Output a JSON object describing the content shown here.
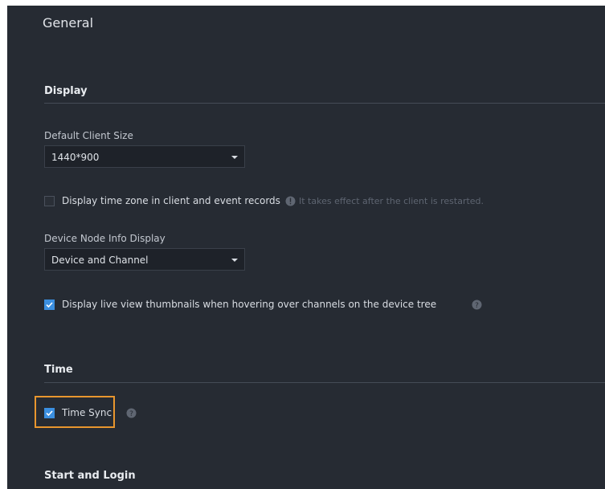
{
  "page": {
    "title": "General"
  },
  "display": {
    "section_title": "Display",
    "client_size": {
      "label": "Default Client Size",
      "value": "1440*900"
    },
    "time_zone": {
      "checked": false,
      "label": "Display time zone in client and event records",
      "hint": "It takes effect after the client is restarted."
    },
    "node_info": {
      "label": "Device Node Info Display",
      "value": "Device and Channel"
    },
    "thumbnails": {
      "checked": true,
      "label": "Display live view thumbnails when hovering over channels on the device tree"
    }
  },
  "time": {
    "section_title": "Time",
    "time_sync": {
      "checked": true,
      "label": "Time Sync"
    }
  },
  "start_login": {
    "section_title": "Start and Login"
  },
  "colors": {
    "background": "#262b33",
    "accent": "#3b8fe0",
    "highlight": "#e8962e"
  }
}
